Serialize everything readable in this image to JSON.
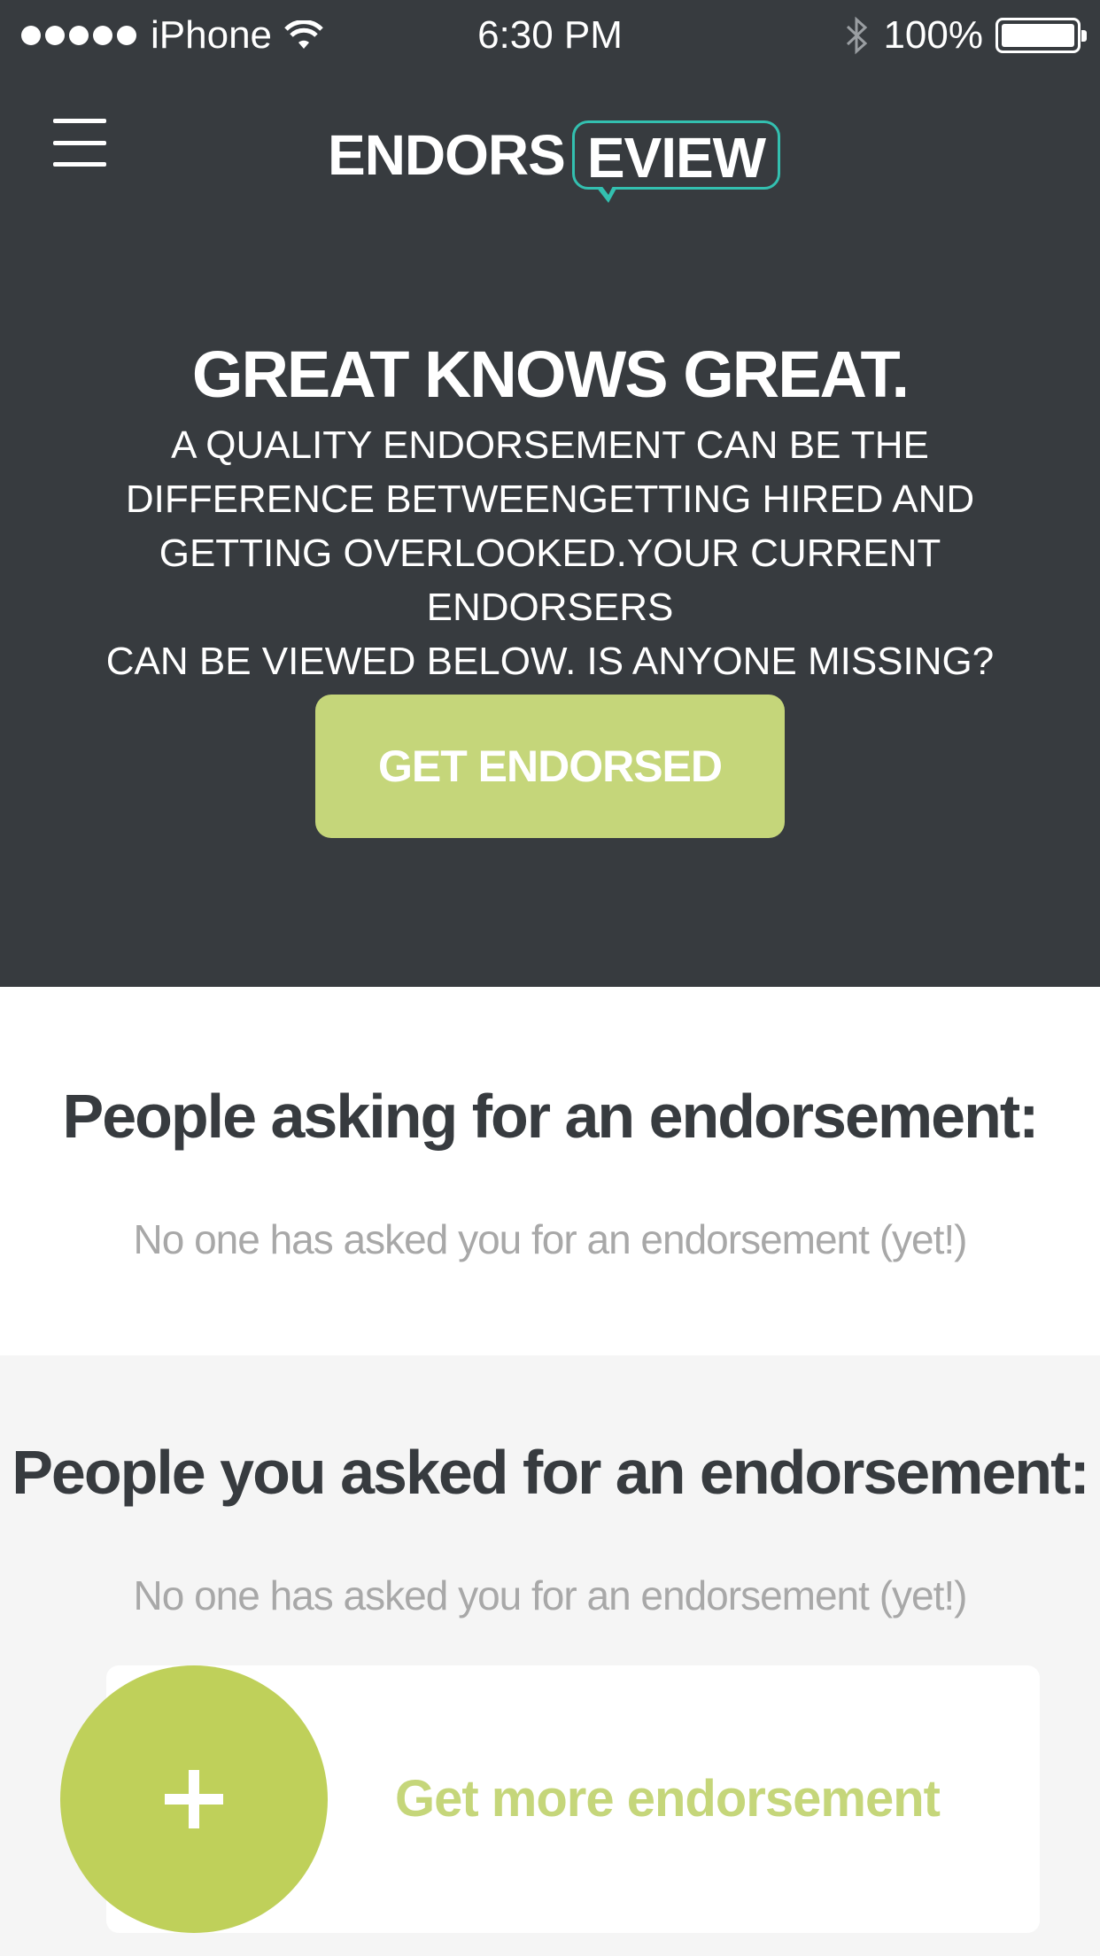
{
  "status_bar": {
    "carrier": "iPhone",
    "time": "6:30 PM",
    "battery": "100%",
    "battery_level": 1.0,
    "signal_bars": 5,
    "icons": [
      "wifi-icon",
      "bluetooth-icon",
      "battery-icon"
    ]
  },
  "header": {
    "logo_left": "ENDORS",
    "logo_right": "EVIEW",
    "menu_icon": "hamburger-icon"
  },
  "hero": {
    "title": "GREAT KNOWS GREAT.",
    "lines": [
      "A QUALITY ENDORSEMENT CAN BE THE",
      "DIFFERENCE BETWEENGETTING HIRED AND",
      "GETTING OVERLOOKED.YOUR CURRENT ENDORSERS",
      "CAN BE VIEWED BELOW. IS ANYONE MISSING?"
    ],
    "cta_label": "GET ENDORSED"
  },
  "asking_section": {
    "title": "People asking for an endorsement:",
    "empty_text": "No one has asked you for an endorsement (yet!)"
  },
  "asked_section": {
    "title": "People you asked for an endorsement:",
    "empty_text": "No one has asked you for an endorsement (yet!)",
    "more_label": "Get more endorsement",
    "more_icon": "plus-icon"
  },
  "colors": {
    "header_bg": "#373b3f",
    "accent_green": "#c5d67a",
    "circle_green": "#bfd05a",
    "logo_teal": "#33c0b0",
    "muted_text": "#a8a8a8"
  }
}
